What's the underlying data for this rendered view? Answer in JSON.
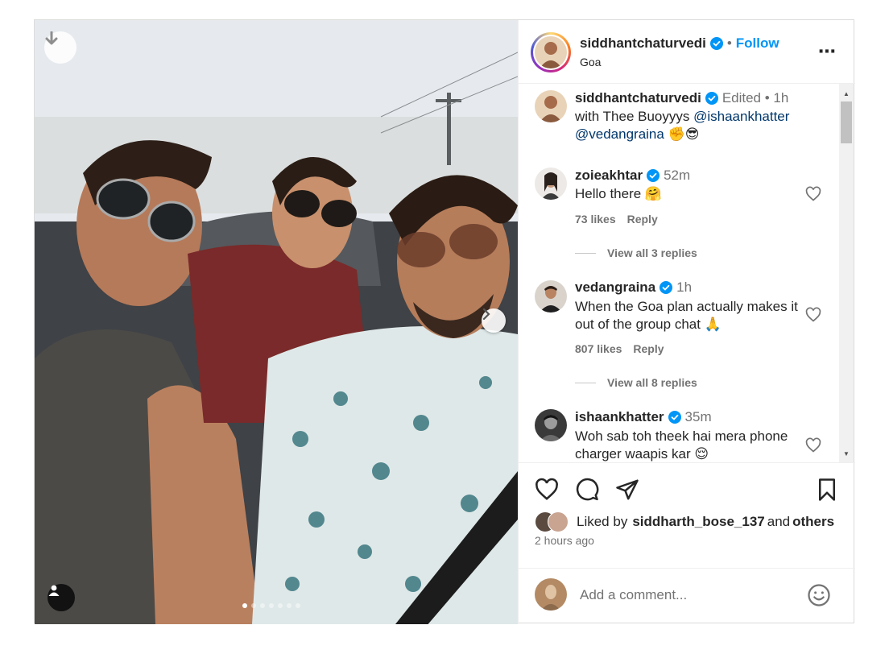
{
  "post": {
    "author": "siddhantchaturvedi",
    "location": "Goa",
    "follow_label": "Follow",
    "separator": "•",
    "more_icon": "⋯"
  },
  "carousel": {
    "slide_count": 7,
    "active_index": 0
  },
  "caption": {
    "user": "siddhantchaturvedi",
    "meta": "Edited •  1h",
    "text_prefix": "with Thee Buoyyys ",
    "mention1": "@ishaankhatter",
    "mention2": "@vedangraina",
    "emoji": " ✊😎"
  },
  "comments": [
    {
      "user": "zoieakhtar",
      "time": "52m",
      "text": "Hello there 🤗",
      "likes": "73 likes",
      "reply": "Reply",
      "view_replies": "View all 3 replies"
    },
    {
      "user": "vedangraina",
      "time": "1h",
      "text": "When the Goa plan actually makes it out of the group chat 🙏",
      "likes": "807 likes",
      "reply": "Reply",
      "view_replies": "View all 8 replies"
    },
    {
      "user": "ishaankhatter",
      "time": "35m",
      "text": "Woh sab toh theek hai mera phone charger waapis kar 😌"
    }
  ],
  "liked_by": {
    "prefix": "Liked by ",
    "user": "siddharth_bose_137",
    "middle": " and ",
    "others": "others"
  },
  "timestamp": "2 hours ago",
  "add_comment": {
    "placeholder": "Add a comment..."
  },
  "colors": {
    "link": "#0095f6",
    "text": "#262626",
    "muted": "#737373",
    "mention": "#00376b",
    "verified": "#0095f6"
  }
}
